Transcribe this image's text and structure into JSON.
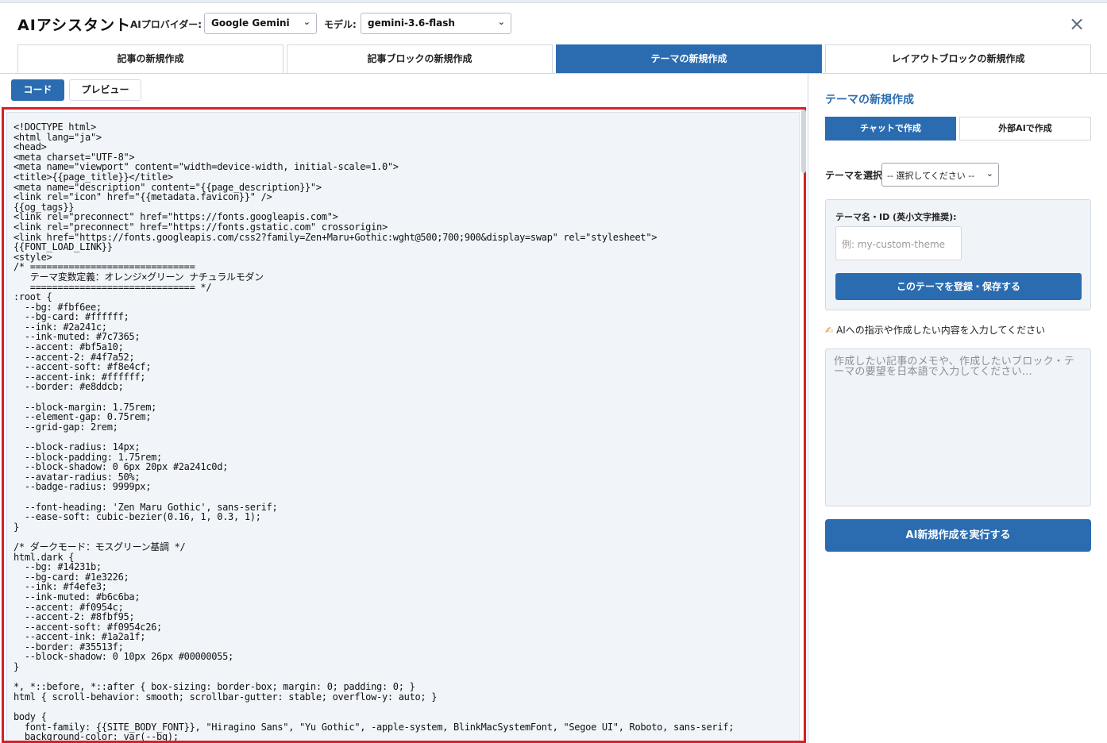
{
  "header": {
    "title": "AIアシスタント",
    "provider_label": "AIプロバイダー:",
    "provider_value": "Google Gemini",
    "model_label": "モデル:",
    "model_value": "gemini-3.6-flash",
    "close_icon": "×"
  },
  "tabs": [
    {
      "label": "記事の新規作成",
      "active": false
    },
    {
      "label": "記事ブロックの新規作成",
      "active": false
    },
    {
      "label": "テーマの新規作成",
      "active": true
    },
    {
      "label": "レイアウトブロックの新規作成",
      "active": false
    }
  ],
  "view_toggle": {
    "code": "コード",
    "preview": "プレビュー",
    "active": "code"
  },
  "code": "<!DOCTYPE html>\n<html lang=\"ja\">\n<head>\n<meta charset=\"UTF-8\">\n<meta name=\"viewport\" content=\"width=device-width, initial-scale=1.0\">\n<title>{{page_title}}</title>\n<meta name=\"description\" content=\"{{page_description}}\">\n<link rel=\"icon\" href=\"{{metadata.favicon}}\" />\n{{og_tags}}\n<link rel=\"preconnect\" href=\"https://fonts.googleapis.com\">\n<link rel=\"preconnect\" href=\"https://fonts.gstatic.com\" crossorigin>\n<link href=\"https://fonts.googleapis.com/css2?family=Zen+Maru+Gothic:wght@500;700;900&display=swap\" rel=\"stylesheet\">\n{{FONT_LOAD_LINK}}\n<style>\n/* ==============================\n   テーマ変数定義：オレンジ×グリーン ナチュラルモダン\n   ============================== */\n:root {\n  --bg: #fbf6ee;\n  --bg-card: #ffffff;\n  --ink: #2a241c;\n  --ink-muted: #7c7365;\n  --accent: #bf5a10;\n  --accent-2: #4f7a52;\n  --accent-soft: #f8e4cf;\n  --accent-ink: #ffffff;\n  --border: #e8ddcb;\n\n  --block-margin: 1.75rem;\n  --element-gap: 0.75rem;\n  --grid-gap: 2rem;\n\n  --block-radius: 14px;\n  --block-padding: 1.75rem;\n  --block-shadow: 0 6px 20px #2a241c0d;\n  --avatar-radius: 50%;\n  --badge-radius: 9999px;\n\n  --font-heading: 'Zen Maru Gothic', sans-serif;\n  --ease-soft: cubic-bezier(0.16, 1, 0.3, 1);\n}\n\n/* ダークモード：モスグリーン基調 */\nhtml.dark {\n  --bg: #14231b;\n  --bg-card: #1e3226;\n  --ink: #f4efe3;\n  --ink-muted: #b6c6ba;\n  --accent: #f0954c;\n  --accent-2: #8fbf95;\n  --accent-soft: #f0954c26;\n  --accent-ink: #1a2a1f;\n  --border: #35513f;\n  --block-shadow: 0 10px 26px #00000055;\n}\n\n*, *::before, *::after { box-sizing: border-box; margin: 0; padding: 0; }\nhtml { scroll-behavior: smooth; scrollbar-gutter: stable; overflow-y: auto; }\n\nbody {\n  font-family: {{SITE_BODY_FONT}}, \"Hiragino Sans\", \"Yu Gothic\", -apple-system, BlinkMacSystemFont, \"Segoe UI\", Roboto, sans-serif;\n  background-color: var(--bg);",
  "panel": {
    "title": "テーマの新規作成",
    "mode_tabs": {
      "chat": "チャットで作成",
      "external": "外部AIで作成",
      "active": "chat"
    },
    "theme_select_label": "テーマを選択",
    "theme_select_value": "-- 選択してください --",
    "id_label": "テーマ名・ID (英小文字推奨):",
    "id_placeholder": "例: my-custom-theme",
    "save_button": "このテーマを登録・保存する",
    "prompt_hint": "AIへの指示や作成したい内容を入力してください",
    "prompt_placeholder": "作成したい記事のメモや、作成したいブロック・テーマの要望を日本語で入力してください...",
    "run_button": "AI新規作成を実行する"
  },
  "colors": {
    "accent": "#2b6cb0",
    "highlight_border": "#d6202a"
  }
}
